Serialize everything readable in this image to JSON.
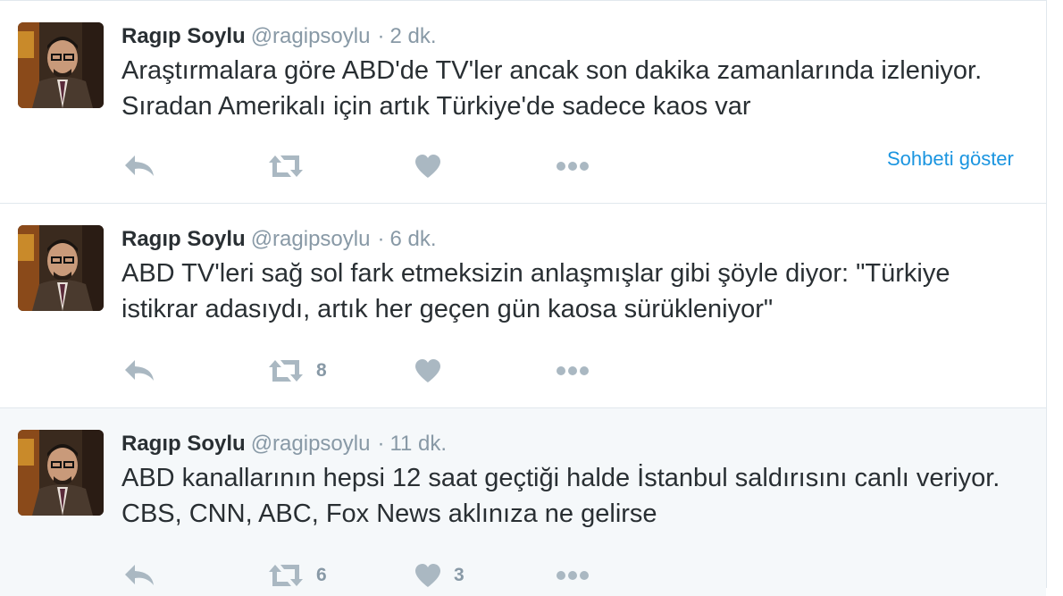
{
  "tweets": [
    {
      "name": "Ragıp Soylu",
      "handle": "@ragipsoylu",
      "separator": "·",
      "time": "2 dk.",
      "text": "Araştırmalara göre ABD'de TV'ler ancak son dakika zamanlarında izleniyor. Sıradan Amerikalı için artık Türkiye'de sadece kaos var",
      "retweets": "",
      "likes": "",
      "show_conversation": "Sohbeti göster",
      "highlighted": false
    },
    {
      "name": "Ragıp Soylu",
      "handle": "@ragipsoylu",
      "separator": "·",
      "time": "6 dk.",
      "text": "ABD TV'leri sağ sol fark etmeksizin anlaşmışlar gibi şöyle diyor: \"Türkiye istikrar adasıydı, artık her geçen gün kaosa sürükleniyor\"",
      "retweets": "8",
      "likes": "",
      "highlighted": false
    },
    {
      "name": "Ragıp Soylu",
      "handle": "@ragipsoylu",
      "separator": "·",
      "time": "11 dk.",
      "text": "ABD kanallarının hepsi 12 saat geçtiği halde İstanbul saldırısını canlı veriyor. CBS, CNN, ABC, Fox News aklınıza ne gelirse",
      "retweets": "6",
      "likes": "3",
      "highlighted": true
    }
  ],
  "icons": {
    "reply": "reply-icon",
    "retweet": "retweet-icon",
    "like": "heart-icon",
    "more": "more-icon"
  },
  "colors": {
    "icon": "#aab8c2",
    "link": "#1b95e0",
    "text": "#292f33",
    "muted": "#8899a6",
    "highlight_bg": "#f5f8fa"
  }
}
